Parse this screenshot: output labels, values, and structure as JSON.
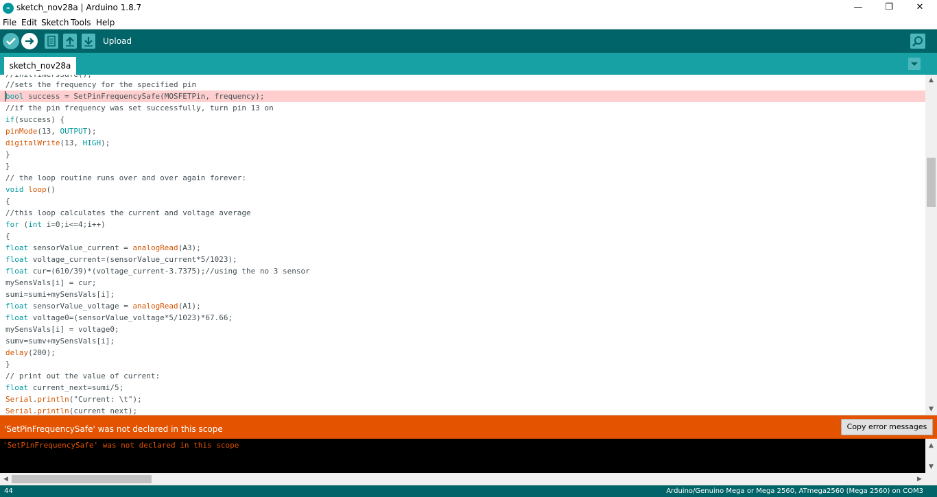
{
  "window": {
    "title": "sketch_nov28a | Arduino 1.8.7",
    "minimize_glyph": "—",
    "maximize_glyph": "❐",
    "close_glyph": "✕"
  },
  "menu": [
    "File",
    "Edit",
    "Sketch",
    "Tools",
    "Help"
  ],
  "toolbar": {
    "hover_label": "Upload",
    "buttons": [
      {
        "name": "verify",
        "icon": "check-icon"
      },
      {
        "name": "upload",
        "icon": "arrow-right-icon"
      },
      {
        "name": "new",
        "icon": "document-icon"
      },
      {
        "name": "open",
        "icon": "arrow-up-icon"
      },
      {
        "name": "save",
        "icon": "arrow-down-icon"
      },
      {
        "name": "serial-monitor",
        "icon": "magnifier-icon"
      }
    ]
  },
  "tabs": [
    {
      "label": "sketch_nov28a",
      "active": true
    }
  ],
  "editor": {
    "partial_top_line": "//InitTimersSafe();",
    "lines": [
      {
        "text": "//sets the frequency for the specified pin"
      },
      {
        "text": "bool success = SetPinFrequencySafe(MOSFETPin, frequency);",
        "highlight": true
      },
      {
        "text": "//if the pin frequency was set successfully, turn pin 13 on"
      },
      {
        "text": "if(success) {"
      },
      {
        "text": "pinMode(13, OUTPUT);"
      },
      {
        "text": "digitalWrite(13, HIGH);"
      },
      {
        "text": "}"
      },
      {
        "text": "}"
      },
      {
        "text": "// the loop routine runs over and over again forever:"
      },
      {
        "text": "void loop()"
      },
      {
        "text": "{"
      },
      {
        "text": "//this loop calculates the current and voltage average"
      },
      {
        "text": "for (int i=0;i<=4;i++)"
      },
      {
        "text": "{"
      },
      {
        "text": "float sensorValue_current = analogRead(A3);"
      },
      {
        "text": "float voltage_current=(sensorValue_current*5/1023);"
      },
      {
        "text": "float cur=(610/39)*(voltage_current-3.7375);//using the no 3 sensor"
      },
      {
        "text": "mySensVals[i] = cur;"
      },
      {
        "text": "sumi=sumi+mySensVals[i];"
      },
      {
        "text": "float sensorValue_voltage = analogRead(A1);"
      },
      {
        "text": "float voltage0=(sensorValue_voltage*5/1023)*67.66;"
      },
      {
        "text": "mySensVals[i] = voltage0;"
      },
      {
        "text": "sumv=sumv+mySensVals[i];"
      },
      {
        "text": "delay(200);"
      },
      {
        "text": "}"
      },
      {
        "text": "// print out the value of current:"
      },
      {
        "text": "float current_next=sumi/5;"
      },
      {
        "text": "Serial.println(\"Current: \\t\");"
      },
      {
        "text": "Serial.println(current_next);"
      }
    ]
  },
  "error_bar": {
    "message": "'SetPinFrequencySafe' was not declared in this scope",
    "copy_button": "Copy error messages"
  },
  "console": {
    "text": "'SetPinFrequencySafe' was not declared in this scope"
  },
  "status": {
    "line_number": "44",
    "board": "Arduino/Genuino Mega or Mega 2560, ATmega2560 (Mega 2560) on COM3"
  },
  "colors": {
    "toolbar": "#006468",
    "tabbar": "#17a1a5",
    "error": "#e35300",
    "highlight_line": "#ffcfcf",
    "keyword": "#00979c",
    "function": "#d35400"
  }
}
